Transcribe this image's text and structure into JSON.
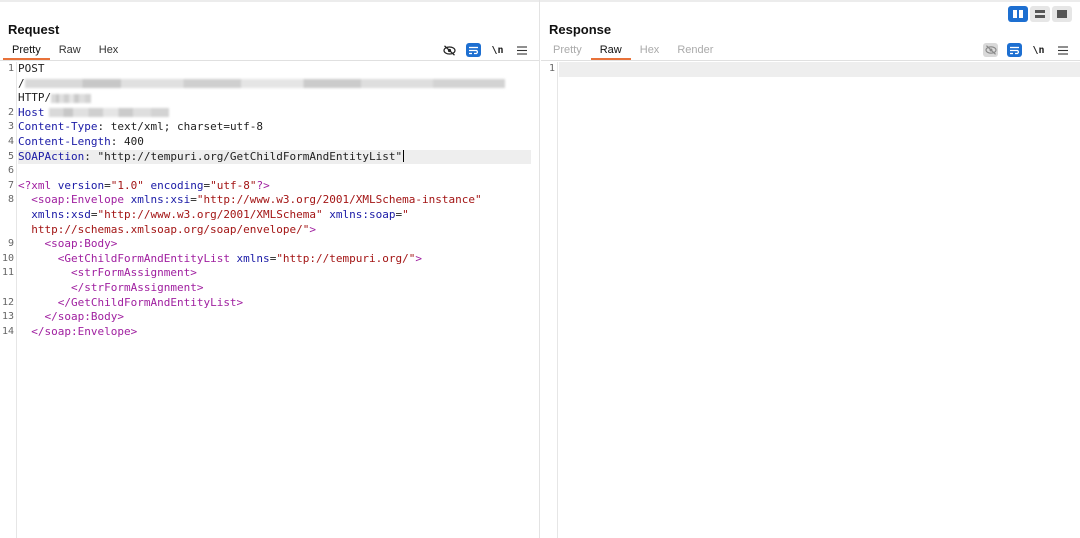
{
  "layout": {
    "modes": [
      "split-vertical",
      "split-horizontal",
      "single"
    ],
    "active": "split-vertical"
  },
  "request": {
    "title": "Request",
    "tabs": [
      {
        "label": "Pretty",
        "active": true,
        "disabled": false
      },
      {
        "label": "Raw",
        "active": false,
        "disabled": false
      },
      {
        "label": "Hex",
        "active": false,
        "disabled": false
      }
    ],
    "tools": {
      "newline_label": "\\n",
      "icons": [
        "eye-slash-icon",
        "wrap-icon",
        "newline-icon",
        "menu-icon"
      ]
    },
    "lines": {
      "l1_method": "POST",
      "l1_path_start": "/",
      "l1_proto": "HTTP/",
      "l2_key": "Host",
      "l3_key": "Content-Type",
      "l3_val": " text/xml; charset=utf-8",
      "l4_key": "Content-Length",
      "l4_val": " 400",
      "l5_key": "SOAPAction",
      "l5_val": " \"http://tempuri.org/GetChildFormAndEntityList\"",
      "l7_open": "<?xml",
      "l7_a1": " version",
      "l7_v1": "\"1.0\"",
      "l7_a2": " encoding",
      "l7_v2": "\"utf-8\"",
      "l7_close": "?>",
      "l8_tag": "<soap:Envelope",
      "l8_a1": " xmlns:xsi",
      "l8_v1": "\"http://www.w3.org/2001/XMLSchema-instance\"",
      "l8b_a2": "xmlns:xsd",
      "l8b_v2": "\"http://www.w3.org/2001/XMLSchema\"",
      "l8b_a3": " xmlns:soap",
      "l8b_v3": "\"",
      "l8c_v3": "http://schemas.xmlsoap.org/soap/envelope/\"",
      "l8c_close": ">",
      "l9": "<soap:Body>",
      "l10_tag": "<GetChildFormAndEntityList",
      "l10_a": " xmlns",
      "l10_v": "\"http://tempuri.org/\"",
      "l10_close": ">",
      "l11a": "<strFormAssignment>",
      "l11b": "</strFormAssignment>",
      "l12": "</GetChildFormAndEntityList>",
      "l13": "</soap:Body>",
      "l14": "</soap:Envelope>"
    },
    "line_numbers": [
      "1",
      "2",
      "3",
      "4",
      "5",
      "6",
      "7",
      "8",
      "9",
      "10",
      "11",
      "12",
      "13",
      "14"
    ]
  },
  "response": {
    "title": "Response",
    "tabs": [
      {
        "label": "Pretty",
        "active": false,
        "disabled": true
      },
      {
        "label": "Raw",
        "active": true,
        "disabled": false
      },
      {
        "label": "Hex",
        "active": false,
        "disabled": true
      },
      {
        "label": "Render",
        "active": false,
        "disabled": true
      }
    ],
    "tools": {
      "newline_label": "\\n"
    },
    "line_numbers": [
      "1"
    ]
  },
  "colors": {
    "accent_tab": "#e8723a",
    "toggle_blue": "#1d6fd1",
    "tag": "#a020a0",
    "attr": "#1a1aa6",
    "string": "#a31515"
  }
}
